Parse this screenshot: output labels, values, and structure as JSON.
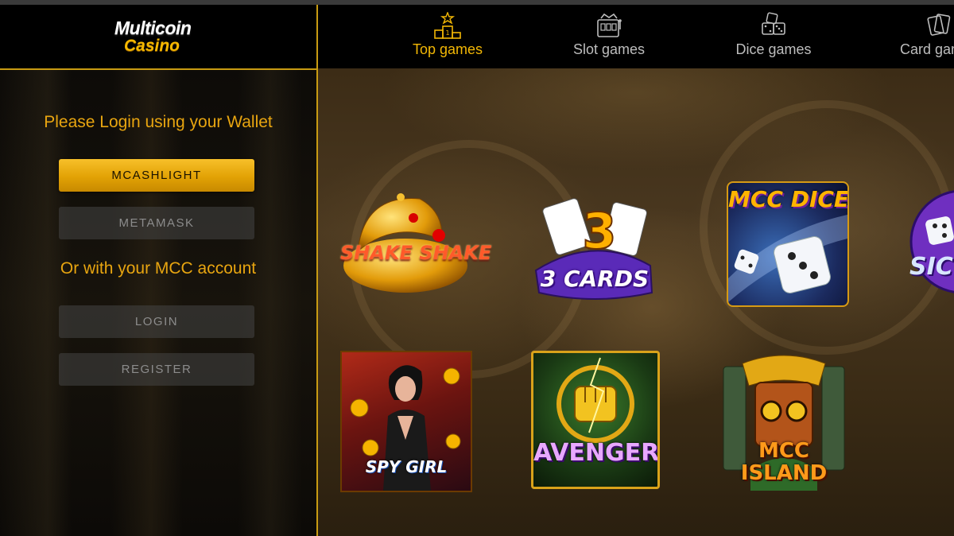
{
  "app": {
    "logo_line1": "Multicoin",
    "logo_line2": "Casino"
  },
  "sidebar": {
    "login_title": "Please Login using your Wallet",
    "mcashlight_label": "MCASHLIGHT",
    "metamask_label": "METAMASK",
    "or_label": "Or with your MCC account",
    "login_label": "LOGIN",
    "register_label": "REGISTER"
  },
  "nav": {
    "items": [
      {
        "label": "Top games",
        "icon": "podium-icon",
        "active": true
      },
      {
        "label": "Slot games",
        "icon": "slot-machine-icon",
        "active": false
      },
      {
        "label": "Dice games",
        "icon": "dice-icon",
        "active": false
      },
      {
        "label": "Card games",
        "icon": "cards-icon",
        "active": false
      }
    ]
  },
  "games": [
    {
      "title": "SHAKE SHAKE"
    },
    {
      "title": "3 CARDS"
    },
    {
      "title": "MCC DICE"
    },
    {
      "title": "SIC"
    },
    {
      "title": "SPY GIRL"
    },
    {
      "title": "AVENGER"
    },
    {
      "title": "MCC ISLAND"
    }
  ],
  "colors": {
    "accent": "#f2b705",
    "gold_button": "#e2a205",
    "divider": "#c89b12",
    "muted_text": "#bdbdbd"
  }
}
